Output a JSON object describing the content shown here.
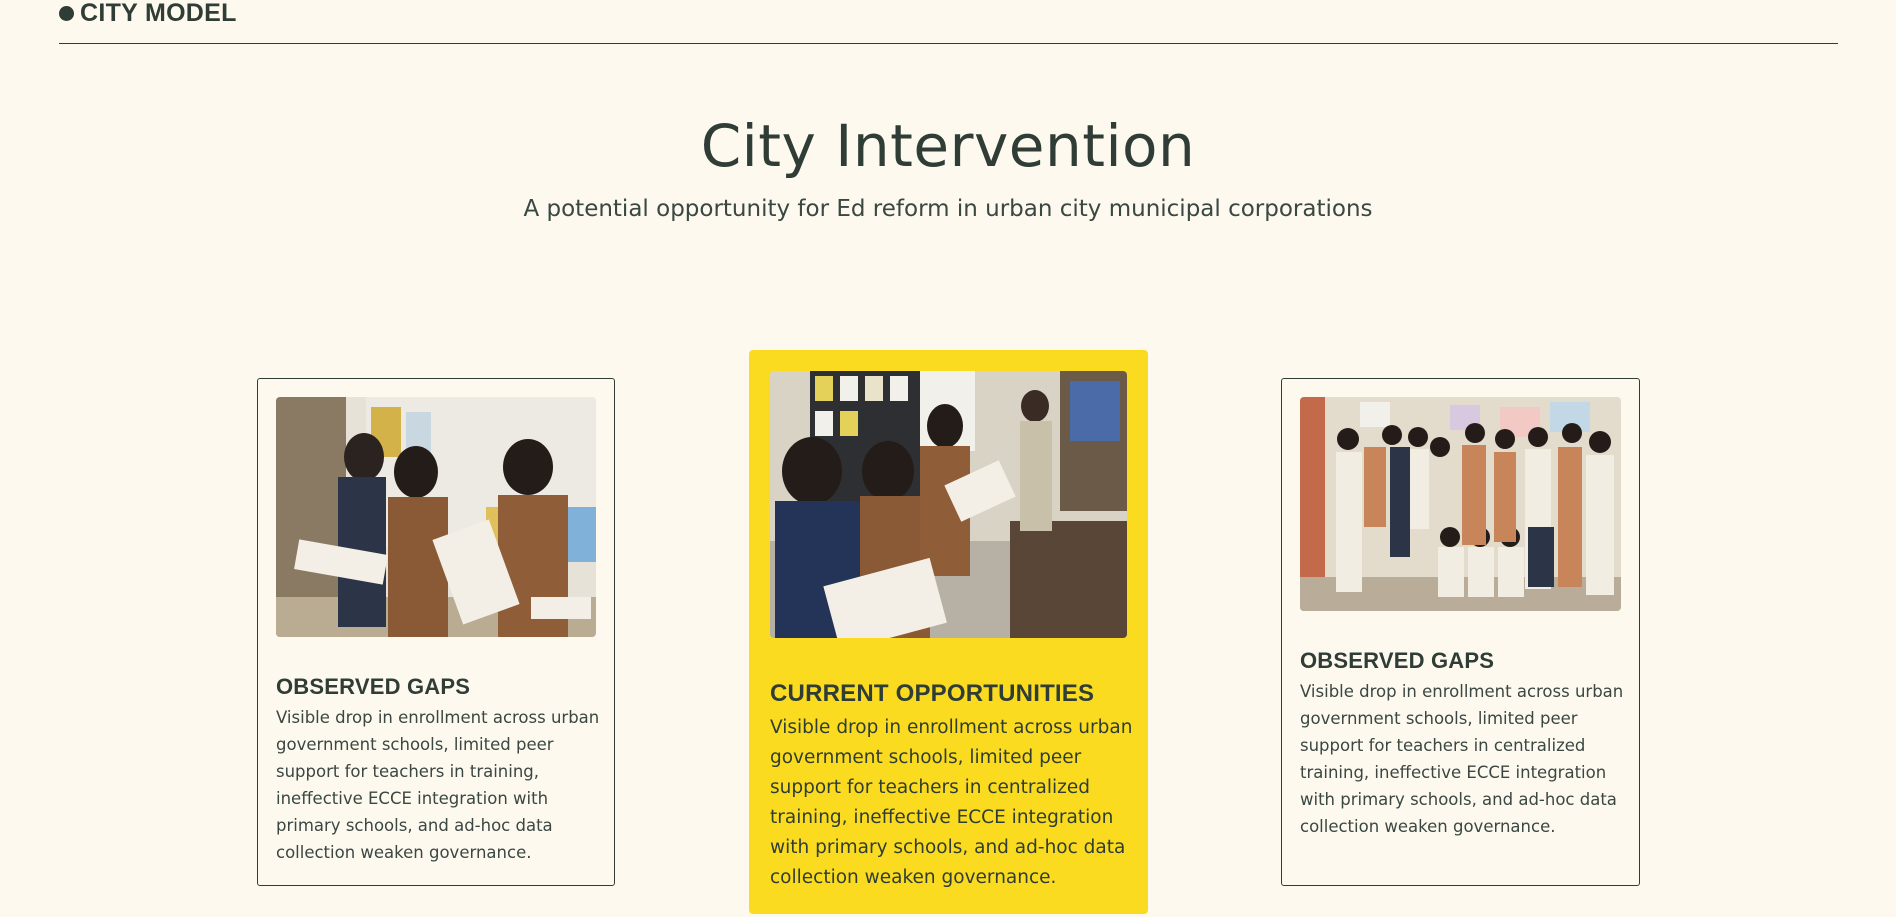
{
  "section": {
    "label": "CITY MODEL"
  },
  "hero": {
    "title": "City Intervention",
    "subtitle": "A potential opportunity for Ed reform in urban city municipal corporations"
  },
  "cards": [
    {
      "heading": "OBSERVED GAPS",
      "body": "Visible drop in enrollment across urban government schools, limited peer support for teachers in training, ineffective ECCE integration with primary schools, and ad-hoc data collection weaken governance.",
      "photo": "students-reading-classroom-photo"
    },
    {
      "heading": "CURRENT OPPORTUNITIES",
      "body": "Visible drop in enrollment across urban government schools, limited peer support for teachers in centralized training, ineffective ECCE integration with primary schools, and ad-hoc data collection weaken governance.",
      "photo": "girls-reading-books-photo",
      "accent": "#fbdb1f"
    },
    {
      "heading": "OBSERVED GAPS",
      "body": "Visible drop in enrollment across urban government schools, limited peer support for teachers in centralized training, ineffective ECCE integration with primary schools, and ad-hoc data collection weaken governance.",
      "photo": "students-group-photo"
    }
  ],
  "colors": {
    "background": "#fdf9ee",
    "text": "#2f3d36",
    "accent": "#fbdb1f"
  }
}
